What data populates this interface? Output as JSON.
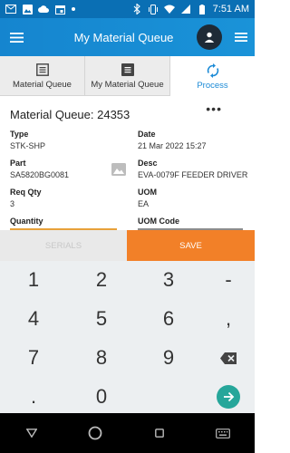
{
  "status_bar": {
    "time": "7:51 AM"
  },
  "app_bar": {
    "title": "My Material Queue"
  },
  "tabs": [
    {
      "label": "Material Queue",
      "icon": "list-icon"
    },
    {
      "label": "My Material Queue",
      "icon": "list-icon"
    },
    {
      "label": "Process",
      "icon": "sync-icon"
    }
  ],
  "detail": {
    "title": "Material Queue: 24353",
    "more_label": "•••",
    "fields": {
      "type": {
        "label": "Type",
        "value": "STK-SHP"
      },
      "date": {
        "label": "Date",
        "value": "21 Mar 2022 15:27"
      },
      "part": {
        "label": "Part",
        "value": "SA5820BG0081"
      },
      "desc": {
        "label": "Desc",
        "value": "EVA-0079F FEEDER DRIVER"
      },
      "req_qty": {
        "label": "Req Qty",
        "value": "3"
      },
      "uom": {
        "label": "UOM",
        "value": "EA"
      },
      "quantity": {
        "label": "Quantity"
      },
      "uom_code": {
        "label": "UOM Code"
      }
    }
  },
  "buttons": {
    "serials": "SERIALS",
    "save": "SAVE"
  },
  "keypad": {
    "rows": [
      [
        "1",
        "2",
        "3",
        "-"
      ],
      [
        "4",
        "5",
        "6",
        ","
      ],
      [
        "7",
        "8",
        "9",
        ""
      ],
      [
        ".",
        "0",
        "",
        ""
      ]
    ]
  },
  "colors": {
    "app_bar": "#1585cf",
    "accent": "#1b8ad6",
    "save": "#f28028",
    "quantity_underline": "#e8a13a",
    "enter_key": "#26a69a"
  }
}
